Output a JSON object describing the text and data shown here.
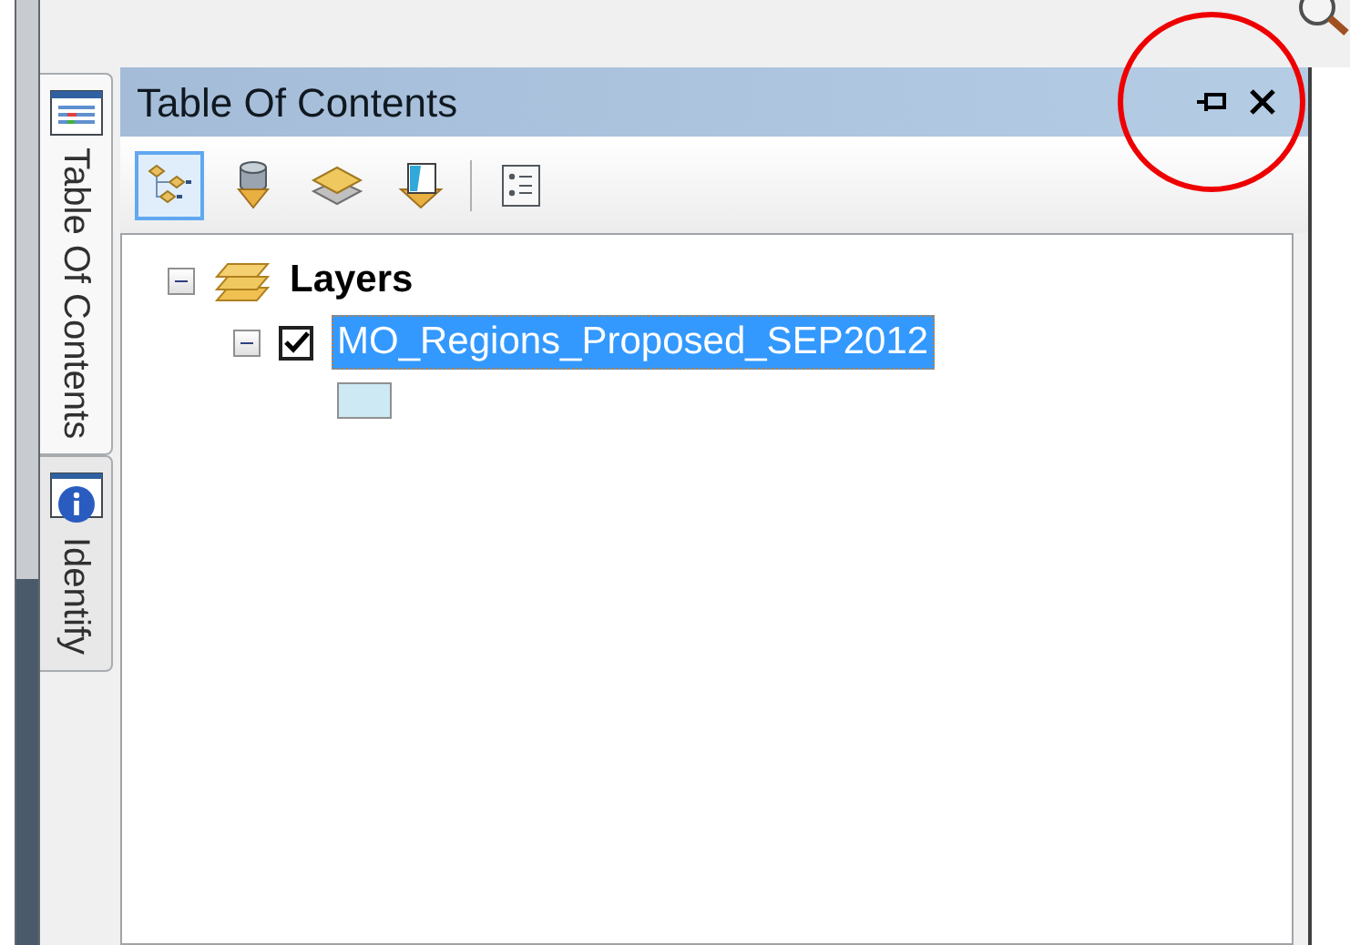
{
  "side_tabs": [
    {
      "label": "Table Of Contents",
      "kind": "contents",
      "selected": true
    },
    {
      "label": "Identify",
      "kind": "identify",
      "selected": false
    }
  ],
  "panel": {
    "title": "Table Of Contents"
  },
  "toolbar": [
    {
      "kind": "drawing-order",
      "selected": true
    },
    {
      "kind": "source",
      "selected": false
    },
    {
      "kind": "visibility",
      "selected": false
    },
    {
      "kind": "selection",
      "selected": false
    },
    {
      "kind": "options",
      "selected": false
    }
  ],
  "tree": [
    {
      "label": "Layers",
      "kind": "frame",
      "expanded": true,
      "children": [
        {
          "label": "MO_Regions_Proposed_SEP2012",
          "kind": "layer",
          "expanded": true,
          "checked": true,
          "selected": true
        }
      ]
    }
  ]
}
